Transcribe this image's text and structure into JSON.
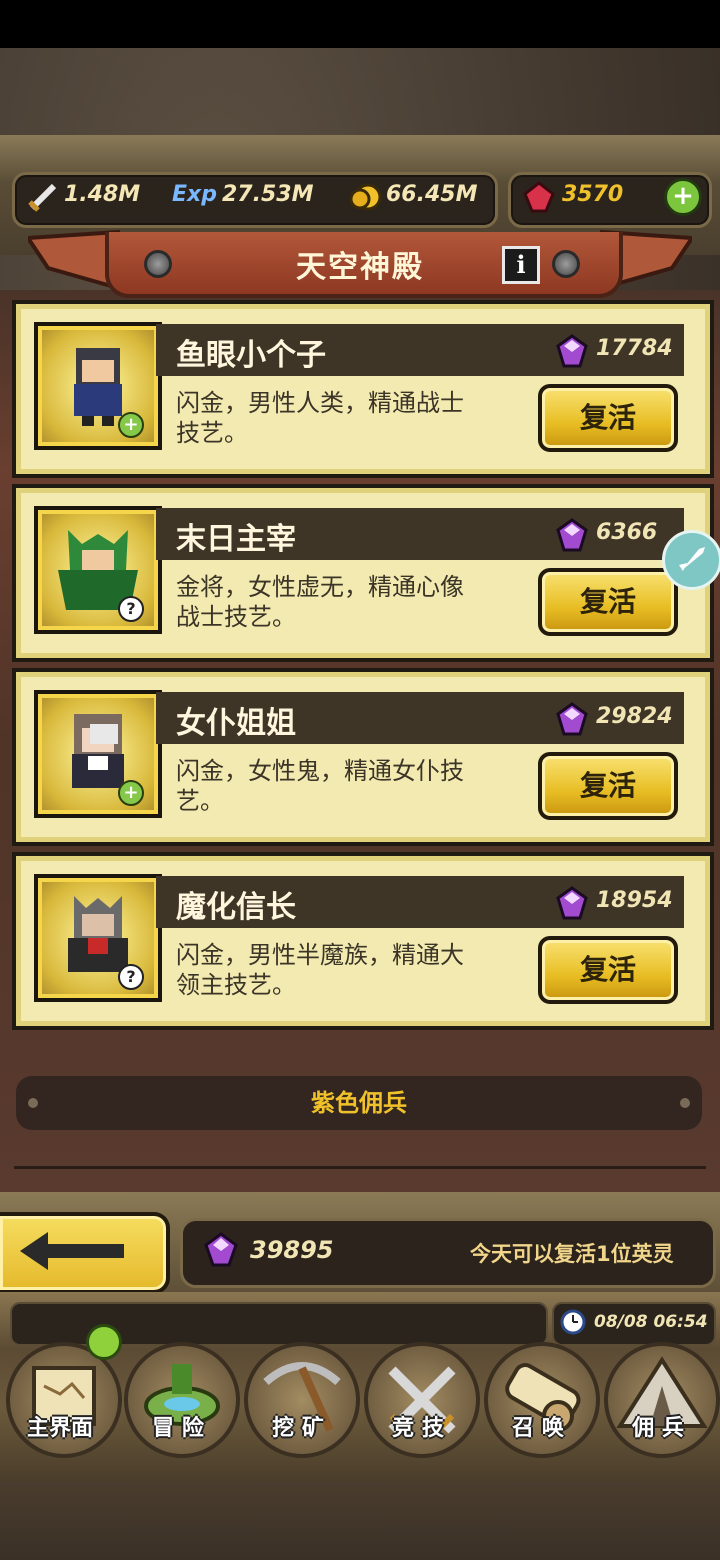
{
  "resources": {
    "sword": "1.48M",
    "exp_icon_text": "Exp",
    "exp": "27.53M",
    "coins": "66.45M",
    "rubies": "3570"
  },
  "header": {
    "title": "天空神殿"
  },
  "heroes": [
    {
      "name": "鱼眼小个子",
      "cost": "17784",
      "desc_line1": "闪金，男性人类，精通战士",
      "desc_line2": "技艺。",
      "button": "复活",
      "badge": "+"
    },
    {
      "name": "末日主宰",
      "cost": "6366",
      "desc_line1": "金将，女性虚无，精通心像",
      "desc_line2": "战士技艺。",
      "button": "复活",
      "badge": "?"
    },
    {
      "name": "女仆姐姐",
      "cost": "29824",
      "desc_line1": "闪金，女性鬼，精通女仆技",
      "desc_line2": "艺。",
      "button": "复活",
      "badge": "+"
    },
    {
      "name": "魔化信长",
      "cost": "18954",
      "desc_line1": "闪金，男性半魔族，精通大",
      "desc_line2": "领主技艺。",
      "button": "复活",
      "badge": "?"
    }
  ],
  "section": {
    "label": "紫色佣兵"
  },
  "footer": {
    "crystals": "39895",
    "revive_notice": "今天可以复活1位英灵"
  },
  "status": {
    "datetime": "08/08 06:54"
  },
  "nav": {
    "tabs": [
      {
        "label": "主界面",
        "icon": "map-scroll-icon"
      },
      {
        "label": "冒 险",
        "icon": "floating-island-icon"
      },
      {
        "label": "挖 矿",
        "icon": "pickaxe-icon"
      },
      {
        "label": "竞 技",
        "icon": "crossed-swords-icon"
      },
      {
        "label": "召 唤",
        "icon": "summon-scroll-icon"
      },
      {
        "label": "佣 兵",
        "icon": "tent-icon"
      }
    ]
  },
  "colors": {
    "accent_gold": "#f0c12a",
    "card_bg": "#f2eab0",
    "gem_purple": "#a24bd1"
  }
}
